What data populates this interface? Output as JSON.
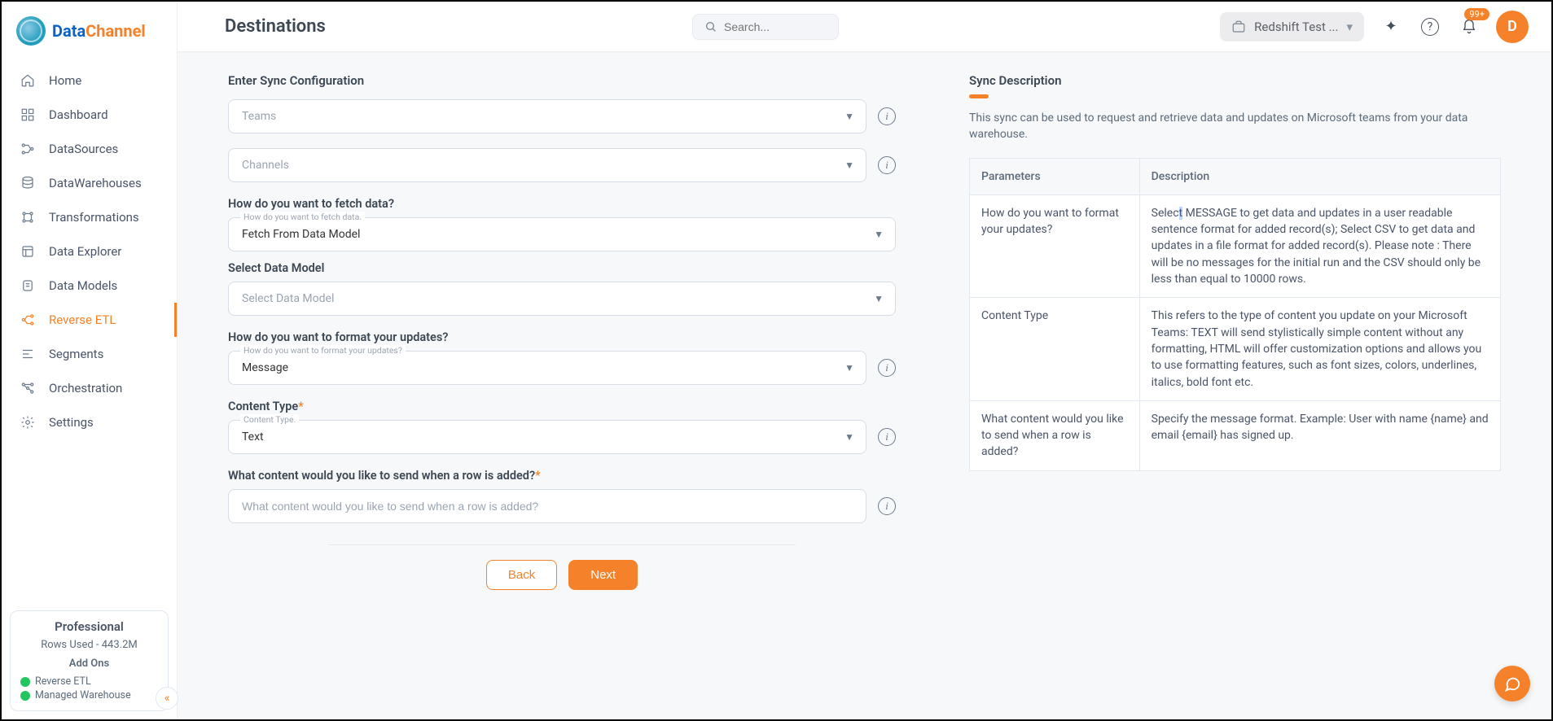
{
  "brand": {
    "part1": "Data",
    "part2": "Channel"
  },
  "sidebar": {
    "items": [
      {
        "label": "Home"
      },
      {
        "label": "Dashboard"
      },
      {
        "label": "DataSources"
      },
      {
        "label": "DataWarehouses"
      },
      {
        "label": "Transformations"
      },
      {
        "label": "Data Explorer"
      },
      {
        "label": "Data Models"
      },
      {
        "label": "Reverse ETL"
      },
      {
        "label": "Segments"
      },
      {
        "label": "Orchestration"
      },
      {
        "label": "Settings"
      }
    ]
  },
  "plan": {
    "title": "Professional",
    "rows": "Rows Used - 443.2M",
    "addons_title": "Add Ons",
    "addons": [
      {
        "label": "Reverse ETL"
      },
      {
        "label": "Managed Warehouse"
      }
    ]
  },
  "header": {
    "page_title": "Destinations",
    "search_placeholder": "Search...",
    "workspace": "Redshift Test ...",
    "notif_count": "99+",
    "avatar_letter": "D"
  },
  "form": {
    "section_title": "Enter Sync Configuration",
    "teams_placeholder": "Teams",
    "channels_placeholder": "Channels",
    "fetch_label": "How do you want to fetch data?",
    "fetch_float": "How do you want to fetch data.",
    "fetch_value": "Fetch From Data Model",
    "model_label": "Select Data Model",
    "model_placeholder": "Select Data Model",
    "format_label": "How do you want to format your updates?",
    "format_float": "How do you want to format your updates?",
    "format_value": "Message",
    "ctype_label": "Content Type",
    "ctype_float": "Content Type.",
    "ctype_value": "Text",
    "content_label": "What content would you like to send when a row is added?",
    "content_placeholder": "What content would you like to send when a row is added?",
    "back": "Back",
    "next": "Next"
  },
  "desc": {
    "title": "Sync Description",
    "text": "This sync can be used to request and retrieve data and updates on Microsoft teams from your data warehouse.",
    "th1": "Parameters",
    "th2": "Description",
    "rows": [
      {
        "param": "How do you want to format your updates?",
        "desc_pre": "Selec",
        "desc_hl": "t",
        "desc_post": " MESSAGE to get data and updates in a user readable sentence format for added record(s); Select CSV to get data and updates in a file format for added record(s). Please note : There will be no messages for the initial run and the CSV should only be less than equal to 10000 rows."
      },
      {
        "param": "Content Type",
        "desc": "This refers to the type of content you update on your Microsoft Teams: TEXT will send stylistically simple content without any formatting, HTML will offer customization options and allows you to use formatting features, such as font sizes, colors, underlines, italics, bold font etc."
      },
      {
        "param": "What content would you like to send when a row is added?",
        "desc": "Specify the message format. Example: User with name {name} and email {email} has signed up."
      }
    ]
  }
}
